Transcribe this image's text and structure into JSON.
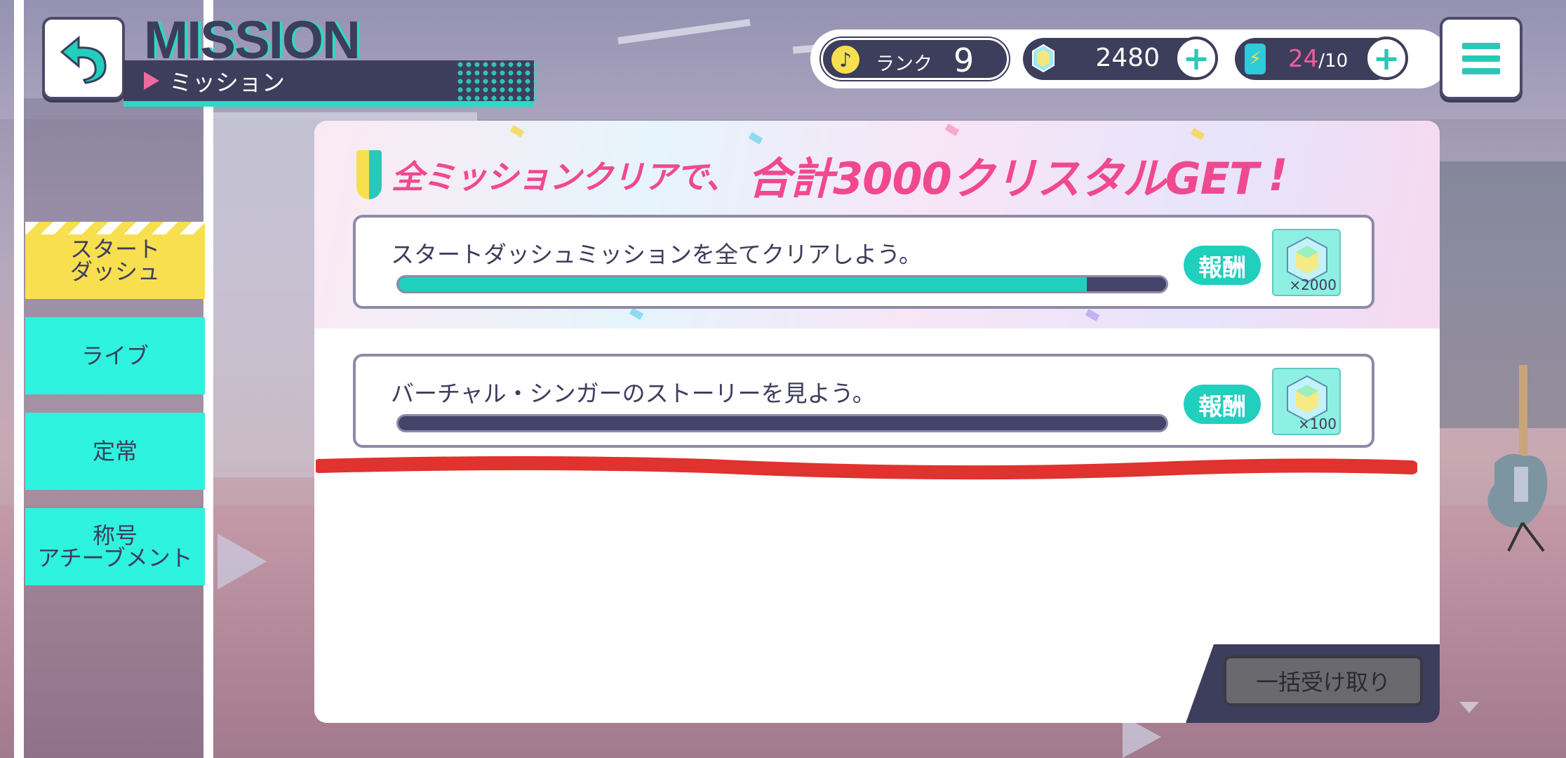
{
  "header": {
    "title_en": "MISSION",
    "title_ja": "ミッション"
  },
  "side_tabs": [
    {
      "label": "スタート\nダッシュ",
      "active": true
    },
    {
      "label": "ライブ",
      "active": false
    },
    {
      "label": "定常",
      "active": false
    },
    {
      "label": "称号\nアチーブメント",
      "active": false
    }
  ],
  "status": {
    "rank_label": "ランク",
    "rank_value": "9",
    "crystals": "2480",
    "energy_current": "24",
    "energy_max": "/10",
    "plus": "+"
  },
  "banner": {
    "prefix": "全ミッションクリアで、",
    "highlight": "合計3000クリスタルGET",
    "suffix": "!"
  },
  "missions": [
    {
      "text": "スタートダッシュミッションを全てクリアしよう。",
      "progress": 0.897,
      "reward_label": "報酬",
      "reward_qty": "×2000"
    },
    {
      "text": "バーチャル・シンガーのストーリーを見よう。",
      "progress": 0,
      "reward_label": "報酬",
      "reward_qty": "×100"
    }
  ],
  "footer": {
    "claim_all_label": "一括受け取り"
  },
  "colors": {
    "teal": "#21cfbd",
    "navy": "#3d3d5c",
    "pink": "#f0498f",
    "yellow": "#f7df4f",
    "annotation_red": "#e0322e"
  }
}
